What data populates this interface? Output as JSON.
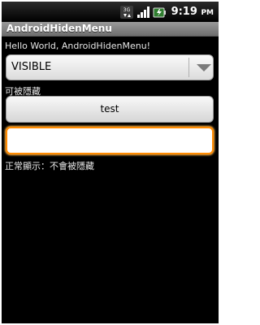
{
  "status_bar": {
    "time": "9:19",
    "time_suffix": "PM",
    "icons": [
      "3g-data-icon",
      "signal-strength-icon",
      "battery-charging-icon"
    ]
  },
  "app": {
    "title": "AndroidHidenMenu"
  },
  "main": {
    "hello_text": "Hello World, AndroidHidenMenu!",
    "spinner": {
      "selected_value": "VISIBLE"
    },
    "hideable_label": "可被隱藏",
    "test_button_label": "test",
    "text_field": {
      "value": "",
      "placeholder": ""
    },
    "normal_label": "正常顯示：不會被隱藏"
  },
  "colors": {
    "focus_border": "#ff8a00",
    "background": "#000000",
    "title_bar": "#8a8a8a"
  }
}
